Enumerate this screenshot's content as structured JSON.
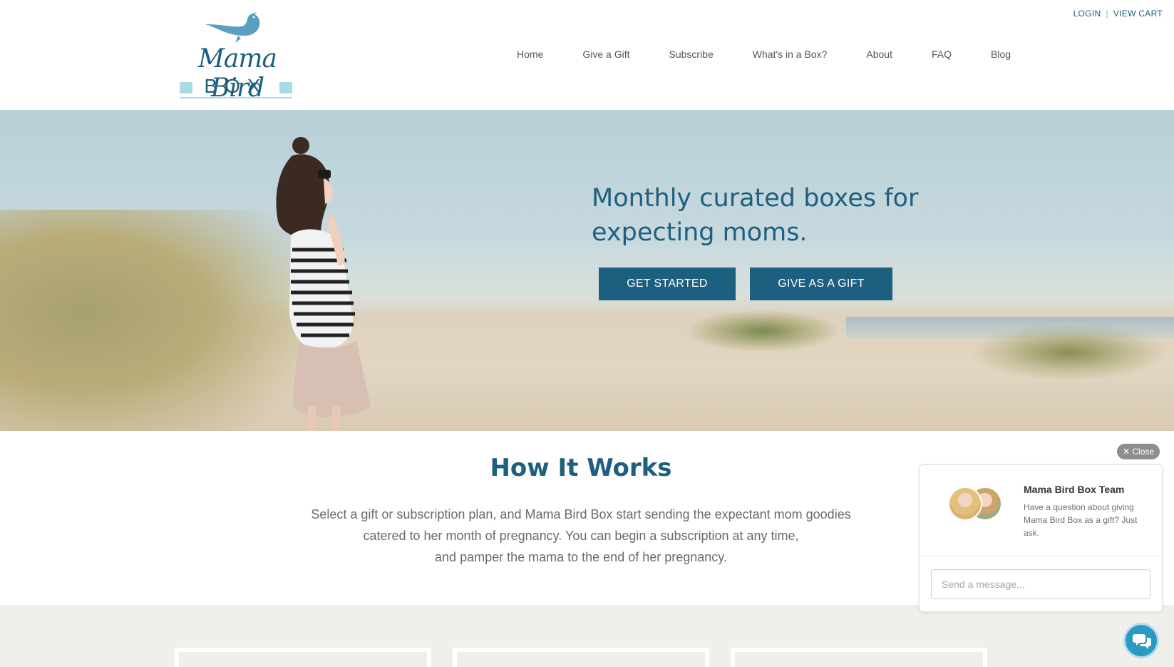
{
  "header": {
    "logo": {
      "text_script": "Mama Bird",
      "text_box": "BOX",
      "icon": "bird-icon"
    },
    "top_links": {
      "login": "LOGIN",
      "separator": "|",
      "view_cart": "VIEW CART"
    },
    "nav": [
      {
        "label": "Home"
      },
      {
        "label": "Give a Gift"
      },
      {
        "label": "Subscribe"
      },
      {
        "label": "What's in a Box?"
      },
      {
        "label": "About"
      },
      {
        "label": "FAQ"
      },
      {
        "label": "Blog"
      }
    ]
  },
  "hero": {
    "title": "Monthly curated boxes for expecting moms.",
    "get_started": "GET STARTED",
    "give_gift": "GIVE AS A GIFT"
  },
  "how": {
    "title": "How It Works",
    "lines": [
      "Select a gift or subscription plan, and Mama Bird Box start sending the expectant mom goodies",
      "catered to her month of pregnancy. You can begin a subscription at any time,",
      "and pamper the mama to the end of her pregnancy."
    ]
  },
  "chat": {
    "close": "Close",
    "team_name": "Mama Bird Box Team",
    "message": "Have a question about giving Mama Bird Box as a gift? Just ask.",
    "input_placeholder": "Send a message..."
  },
  "colors": {
    "brand": "#1d5f7e",
    "light_accent": "#a9dbe5",
    "chat_fab": "#2b9ac3"
  }
}
